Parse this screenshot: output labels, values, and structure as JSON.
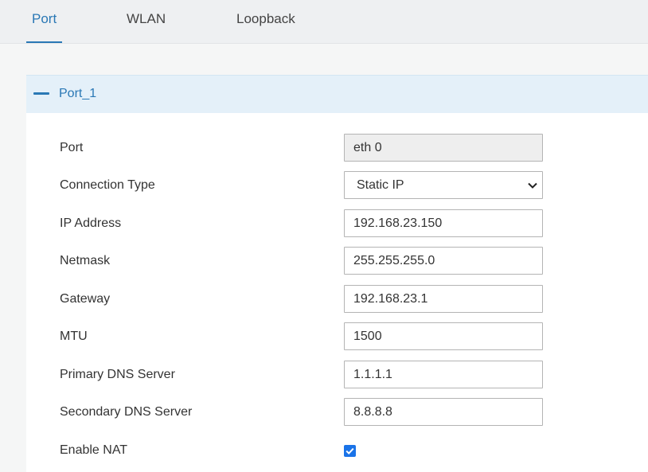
{
  "tabs": [
    {
      "label": "Port",
      "active": true
    },
    {
      "label": "WLAN",
      "active": false
    },
    {
      "label": "Loopback",
      "active": false
    }
  ],
  "section": {
    "title": "Port_1",
    "icon": "collapse-minus-icon"
  },
  "fields": {
    "port": {
      "label": "Port",
      "value": "eth 0"
    },
    "connection_type": {
      "label": "Connection Type",
      "value": "Static IP"
    },
    "ip_address": {
      "label": "IP Address",
      "value": "192.168.23.150"
    },
    "netmask": {
      "label": "Netmask",
      "value": "255.255.255.0"
    },
    "gateway": {
      "label": "Gateway",
      "value": "192.168.23.1"
    },
    "mtu": {
      "label": "MTU",
      "value": "1500"
    },
    "primary_dns": {
      "label": "Primary DNS Server",
      "value": "1.1.1.1"
    },
    "secondary_dns": {
      "label": "Secondary DNS Server",
      "value": "8.8.8.8"
    },
    "enable_nat": {
      "label": "Enable NAT",
      "checked": true
    }
  },
  "colors": {
    "accent": "#2a78b5",
    "header_bg": "#e4f0f9",
    "checkbox": "#1a73e8"
  }
}
